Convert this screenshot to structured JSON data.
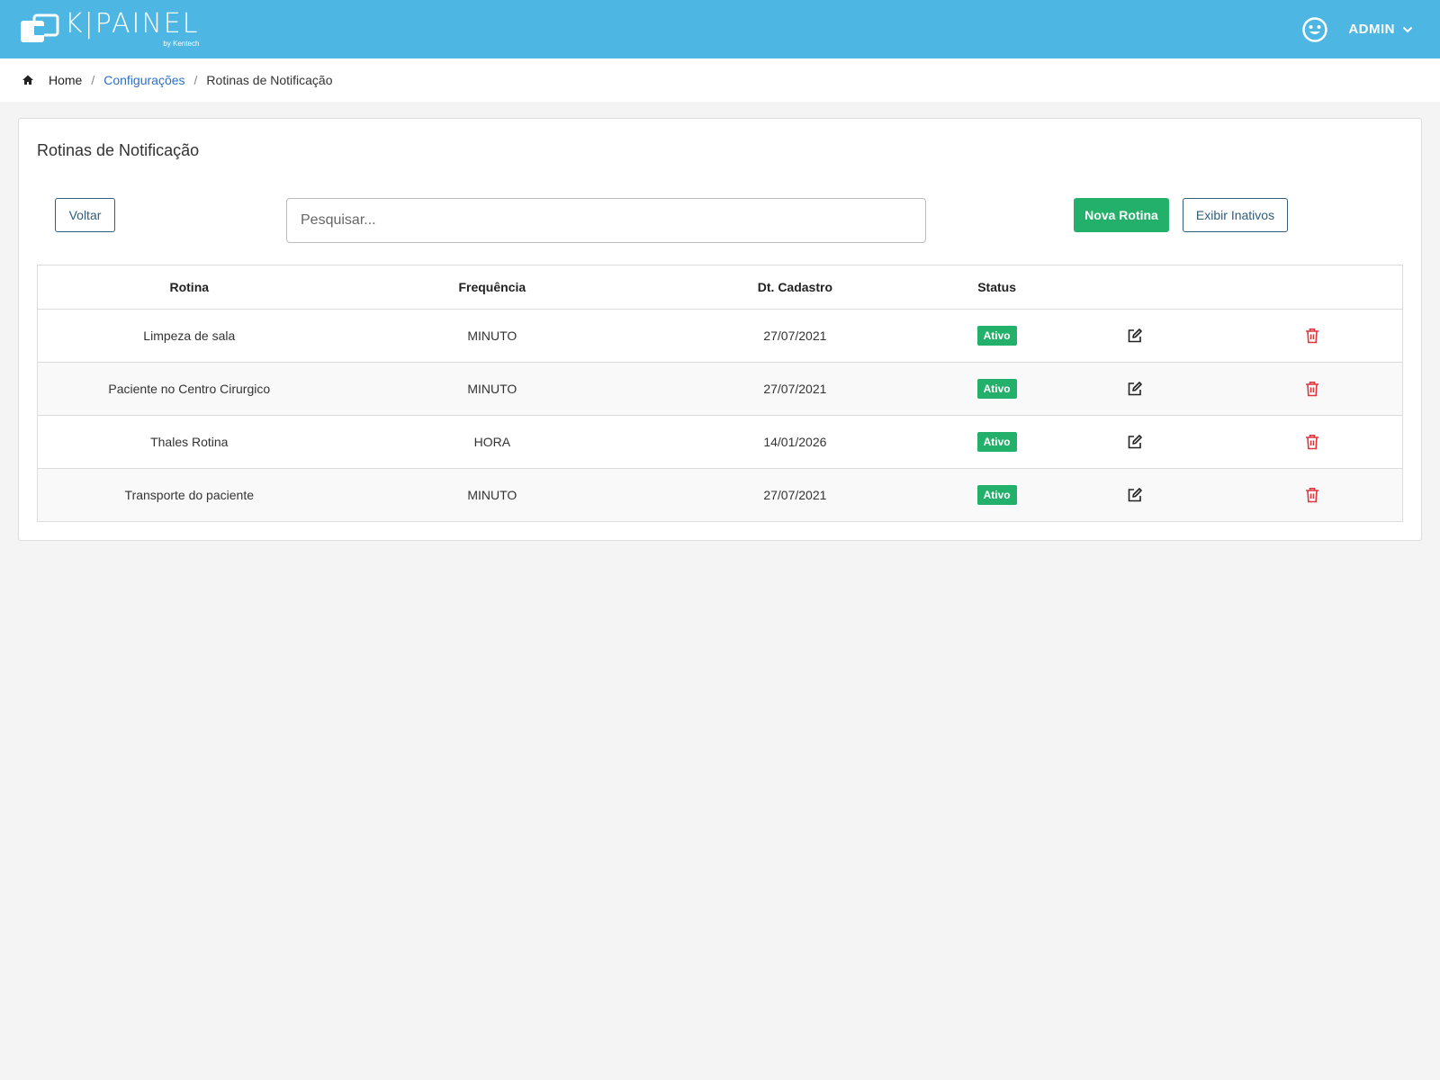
{
  "header": {
    "logo_name": "K|PAINEL",
    "logo_sub": "by Kentech",
    "user_label": "ADMIN",
    "color": "#4db6e2"
  },
  "breadcrumb": {
    "home": "Home",
    "separator": "/",
    "config": "Configurações",
    "current": "Rotinas de Notificação"
  },
  "card": {
    "title": "Rotinas de Notificação",
    "back_label": "Voltar",
    "search_placeholder": "Pesquisar...",
    "new_label": "Nova Rotina",
    "inactive_label": "Exibir Inativos"
  },
  "table": {
    "headers": {
      "rotina": "Rotina",
      "frequencia": "Frequência",
      "dt_cadastro": "Dt. Cadastro",
      "status": "Status"
    },
    "rows": [
      {
        "rotina": "Limpeza de sala",
        "frequencia": "MINUTO",
        "dt_cadastro": "27/07/2021",
        "status": "Ativo"
      },
      {
        "rotina": "Paciente no Centro Cirurgico",
        "frequencia": "MINUTO",
        "dt_cadastro": "27/07/2021",
        "status": "Ativo"
      },
      {
        "rotina": "Thales Rotina",
        "frequencia": "HORA",
        "dt_cadastro": "14/01/2026",
        "status": "Ativo"
      },
      {
        "rotina": "Transporte do paciente",
        "frequencia": "MINUTO",
        "dt_cadastro": "27/07/2021",
        "status": "Ativo"
      }
    ]
  },
  "icons": {
    "edit": "edit-icon",
    "delete": "trash-icon",
    "user": "smiley-icon",
    "home": "home-icon"
  },
  "colors": {
    "success": "#23b06a",
    "danger": "#e0353c",
    "link": "#2d6fc7"
  }
}
